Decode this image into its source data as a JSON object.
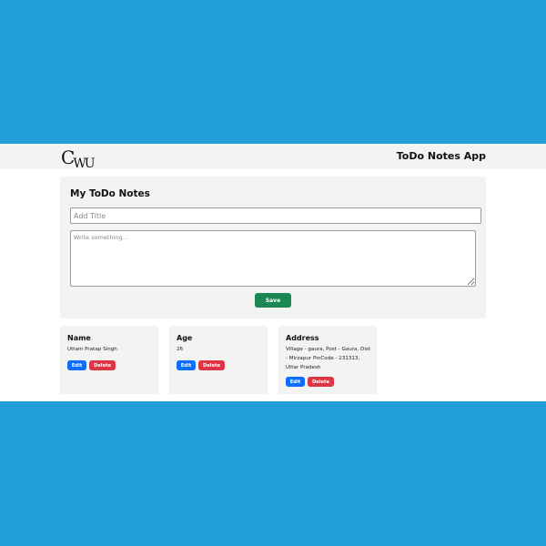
{
  "navbar": {
    "logo_text": "CWU",
    "logo_main": "C",
    "logo_sub": "WU",
    "app_title": "ToDo Notes App"
  },
  "form": {
    "heading": "My ToDo Notes",
    "title_placeholder": "Add Title",
    "body_placeholder": "Write something...",
    "save_label": "Save"
  },
  "notes": [
    {
      "title": "Name",
      "body": "Uttam Pratap Singh",
      "edit_label": "Edit",
      "delete_label": "Delete"
    },
    {
      "title": "Age",
      "body": "26",
      "edit_label": "Edit",
      "delete_label": "Delete"
    },
    {
      "title": "Address",
      "body": "Village - gaura, Post - Gaura, Dist - Mirzapur PinCode - 231313, Uttar Pradesh",
      "edit_label": "Edit",
      "delete_label": "Delete"
    }
  ],
  "colors": {
    "background": "#229fd9",
    "panel": "#f3f3f3",
    "save": "#1d8754",
    "edit": "#0d6efd",
    "delete": "#dc3545"
  }
}
